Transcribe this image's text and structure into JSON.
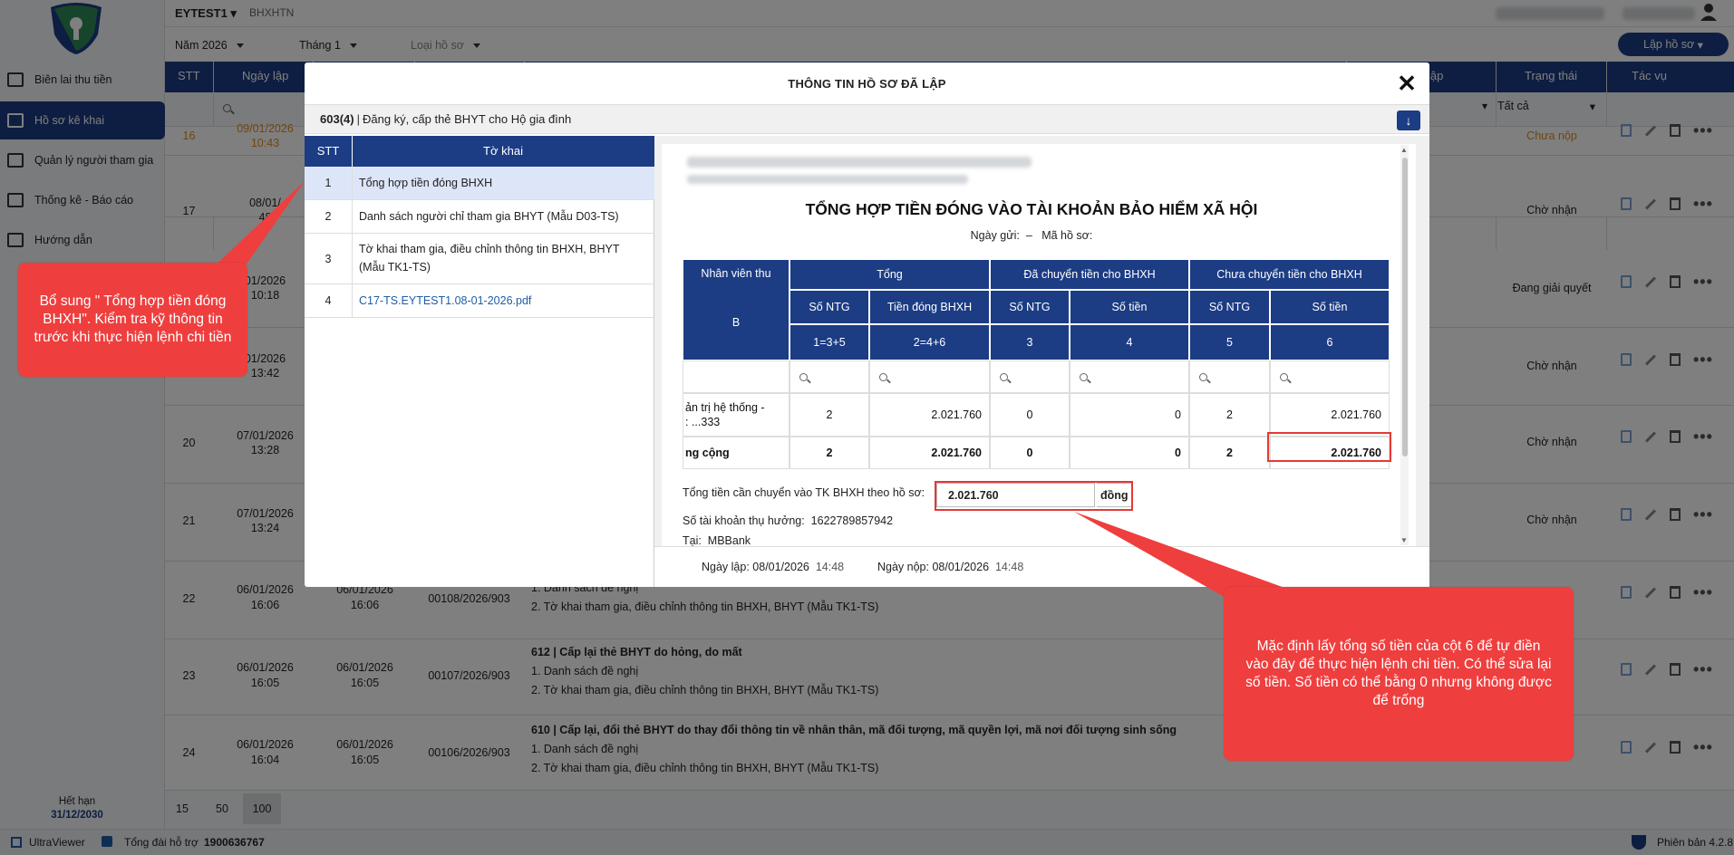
{
  "app": {
    "company": "EYTEST1",
    "company_sub": "BHXHTN",
    "version": "Phiên bản 4.2.8",
    "expiry_label": "Hết hạn",
    "expiry_date": "31/12/2030"
  },
  "sidebar": {
    "items": [
      {
        "label": "Biên lai thu tiền"
      },
      {
        "label": "Hồ sơ kê khai"
      },
      {
        "label": "Quản lý người tham gia"
      },
      {
        "label": "Thống kê - Báo cáo"
      },
      {
        "label": "Hướng dẫn"
      }
    ]
  },
  "filters": {
    "year": "Năm 2026",
    "month": "Tháng 1",
    "type_placeholder": "Loại hồ sơ",
    "create_button": "Lập hồ sơ"
  },
  "table": {
    "headers": {
      "stt": "STT",
      "date": "Ngày lập",
      "date2": "lập",
      "status": "Trạng thái",
      "actions": "Tác vụ"
    },
    "status_filter": "Tất cả",
    "rows": [
      {
        "stt": "16",
        "date": "09/01/2026",
        "time": "10:43",
        "status": "Chưa nộp"
      },
      {
        "stt": "17",
        "date": "08/01/",
        "time": "48",
        "status": "Chờ nhận"
      },
      {
        "stt": "",
        "date": "01/2026",
        "time": "10:18",
        "status": "Đang giải quyết"
      },
      {
        "stt": "",
        "date": "01/2026",
        "time": "13:42",
        "status": "Chờ nhận"
      },
      {
        "stt": "20",
        "date": "07/01/2026",
        "time": "13:28",
        "status": "Chờ nhận"
      },
      {
        "stt": "21",
        "date": "07/01/2026",
        "time": "13:24",
        "status": "Chờ nhận"
      },
      {
        "stt": "22",
        "date": "06/01/2026",
        "time": "16:06",
        "date2": "06/01/2026",
        "time2": "16:06",
        "code": "00108/2026/903",
        "title": "",
        "line1": "1. Danh sách đề nghị",
        "line2": "2. Tờ khai tham gia, điều chỉnh thông tin BHXH, BHYT (Mẫu TK1-TS)"
      },
      {
        "stt": "23",
        "date": "06/01/2026",
        "time": "16:05",
        "date2": "06/01/2026",
        "time2": "16:05",
        "code": "00107/2026/903",
        "title": "612 | Cấp lại thẻ BHYT do hỏng, do mất",
        "line1": "1. Danh sách đề nghị",
        "line2": "2. Tờ khai tham gia, điều chỉnh thông tin BHXH, BHYT (Mẫu TK1-TS)"
      },
      {
        "stt": "24",
        "date": "06/01/2026",
        "time": "16:04",
        "date2": "06/01/2026",
        "time2": "16:05",
        "code": "00106/2026/903",
        "title": "610 | Cấp lại, đổi thẻ BHYT do thay đổi thông tin về nhân thân, mã đối tượng, mã quyền lợi, mã nơi đối tượng sinh sống",
        "line1": "1. Danh sách đề nghị",
        "line2": "2. Tờ khai tham gia, điều chỉnh thông tin BHXH, BHYT (Mẫu TK1-TS)"
      }
    ]
  },
  "pager": [
    "15",
    "50",
    "100"
  ],
  "statusbar": {
    "ultraviewer": "UltraViewer",
    "support_label": "Tổng đài hỗ trợ",
    "support_phone": "1900636767"
  },
  "modal": {
    "title": "THÔNG TIN HỒ SƠ ĐÃ LẬP",
    "code": "603(4)",
    "subtitle": "Đăng ký, cấp thẻ BHYT cho Hộ gia đình",
    "list_header": {
      "stt": "STT",
      "name": "Tờ khai"
    },
    "list": [
      {
        "n": "1",
        "label": "Tổng hợp tiền đóng BHXH"
      },
      {
        "n": "2",
        "label": "Danh sách người chỉ tham gia BHYT (Mẫu D03-TS)"
      },
      {
        "n": "3",
        "label": "Tờ khai tham gia, điều chỉnh thông tin BHXH, BHYT (Mẫu TK1-TS)"
      },
      {
        "n": "4",
        "label": "C17-TS.EYTEST1.08-01-2026.pdf"
      }
    ],
    "doc": {
      "title": "TỔNG HỢP TIỀN ĐÓNG VÀO TÀI KHOẢN BẢO HIỂM XÃ HỘI",
      "sent_label": "Ngày gửi:",
      "sent_value": "–",
      "code_label": "Mã hồ sơ:",
      "headers": {
        "collector": "Nhân viên thu",
        "total": "Tổng",
        "transferred": "Đã chuyển tiền cho BHXH",
        "pending": "Chưa chuyển tiền cho BHXH",
        "ntg": "Số NTG",
        "amount_bhxh": "Tiền đóng BHXH",
        "amount": "Số tiền",
        "b": "B",
        "c1": "1=3+5",
        "c2": "2=4+6",
        "c3": "3",
        "c4": "4",
        "c5": "5",
        "c6": "6"
      },
      "row": {
        "name1": "ản trị hệ thống -",
        "name2": ": ...333",
        "ntg": "2",
        "amount": "2.021.760",
        "t_ntg": "0",
        "t_amount": "0",
        "p_ntg": "2",
        "p_amount": "2.021.760"
      },
      "total_row": {
        "label": "ng cộng",
        "ntg": "2",
        "amount": "2.021.760",
        "t_ntg": "0",
        "t_amount": "0",
        "p_ntg": "2",
        "p_amount": "2.021.760"
      },
      "transfer_label": "Tổng tiền cần chuyển vào TK BHXH theo hồ sơ:",
      "transfer_value": "2.021.760",
      "transfer_unit": "đồng",
      "account_label": "Số tài khoản thụ hưởng:",
      "account_value": "1622789857942",
      "bank_label": "Tại:",
      "bank_value": "MBBank"
    },
    "footer": {
      "created_label": "Ngày lập:",
      "created_date": "08/01/2026",
      "created_time": "14:48",
      "submitted_label": "Ngày nộp:",
      "submitted_date": "08/01/2026",
      "submitted_time": "14:48"
    }
  },
  "callouts": {
    "left": "Bổ sung \" Tổng hợp tiền đóng BHXH\". Kiểm tra kỹ thông tin trước khi thực hiện lệnh chi tiền",
    "right": "Mặc định lấy tổng số tiền của cột 6 để tự điền vào đây để thực hiện lệnh chi tiền. Có thể sửa lại số tiền. Số tiền có thể bằng 0 nhưng không được để trống"
  },
  "colors": {
    "primary": "#1c3c84",
    "callout": "#ef3e3e",
    "highlight": "#e53935"
  }
}
